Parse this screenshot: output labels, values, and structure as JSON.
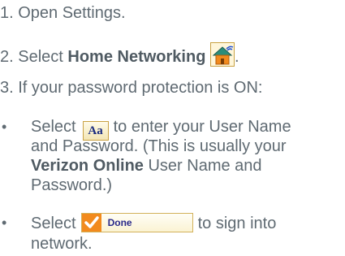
{
  "steps": {
    "s1": "1. Open Settings.",
    "s2_prefix": "2. Select ",
    "s2_bold": "Home Networking",
    "s2_suffix": ".",
    "s3": "3. If your password protection is ON:"
  },
  "bullets": {
    "b1_l1_prefix": "Select",
    "b1_l1_suffix": "to enter your User Name",
    "b1_l2": "and Password. (This is usually your",
    "b1_l3_bold": "Verizon Online",
    "b1_l3_suffix": " User Name and",
    "b1_l4": "Password.)",
    "b2_l1_prefix": "Select",
    "b2_button": "Done",
    "b2_l1_suffix": "to sign into",
    "b2_l2": "network.",
    "bullet_char": "•"
  },
  "icons": {
    "home_networking": "home-networking-icon",
    "keyboard": "aa-keyboard-icon",
    "done": "checkmark-icon"
  }
}
